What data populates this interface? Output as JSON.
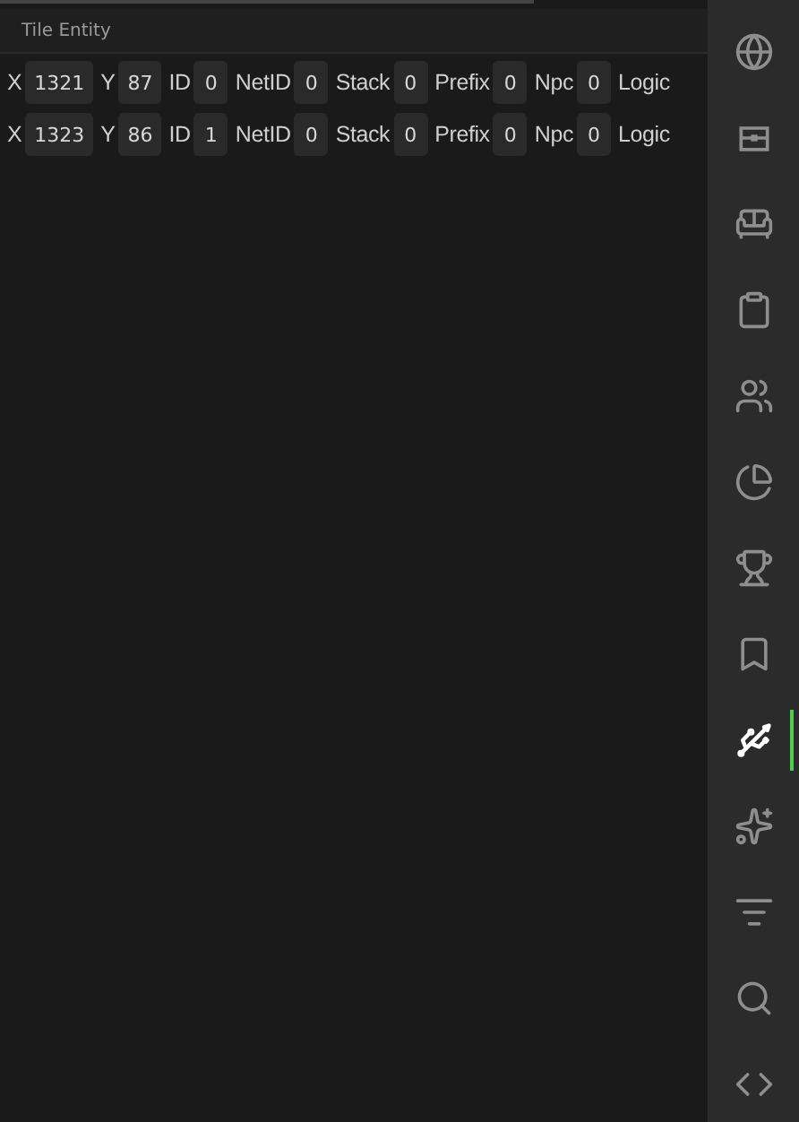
{
  "panel": {
    "title": "Tile Entity"
  },
  "rows": [
    {
      "fields": [
        {
          "label": "X",
          "value": "1321"
        },
        {
          "label": "Y",
          "value": "87"
        },
        {
          "label": "ID",
          "value": "0"
        },
        {
          "label": "NetID",
          "value": "0"
        },
        {
          "label": "Stack",
          "value": "0"
        },
        {
          "label": "Prefix",
          "value": "0"
        },
        {
          "label": "Npc",
          "value": "0"
        },
        {
          "label": "Logic"
        }
      ]
    },
    {
      "fields": [
        {
          "label": "X",
          "value": "1323"
        },
        {
          "label": "Y",
          "value": "86"
        },
        {
          "label": "ID",
          "value": "1"
        },
        {
          "label": "NetID",
          "value": "0"
        },
        {
          "label": "Stack",
          "value": "0"
        },
        {
          "label": "Prefix",
          "value": "0"
        },
        {
          "label": "Npc",
          "value": "0"
        },
        {
          "label": "Logic"
        }
      ]
    }
  ],
  "sidebar": {
    "items": [
      {
        "selected": false
      },
      {
        "selected": false
      },
      {
        "selected": false
      },
      {
        "selected": false
      },
      {
        "selected": false
      },
      {
        "selected": false
      },
      {
        "selected": false
      },
      {
        "selected": false
      },
      {
        "selected": true
      },
      {
        "selected": false
      },
      {
        "selected": false
      },
      {
        "selected": false
      },
      {
        "selected": false
      }
    ]
  }
}
